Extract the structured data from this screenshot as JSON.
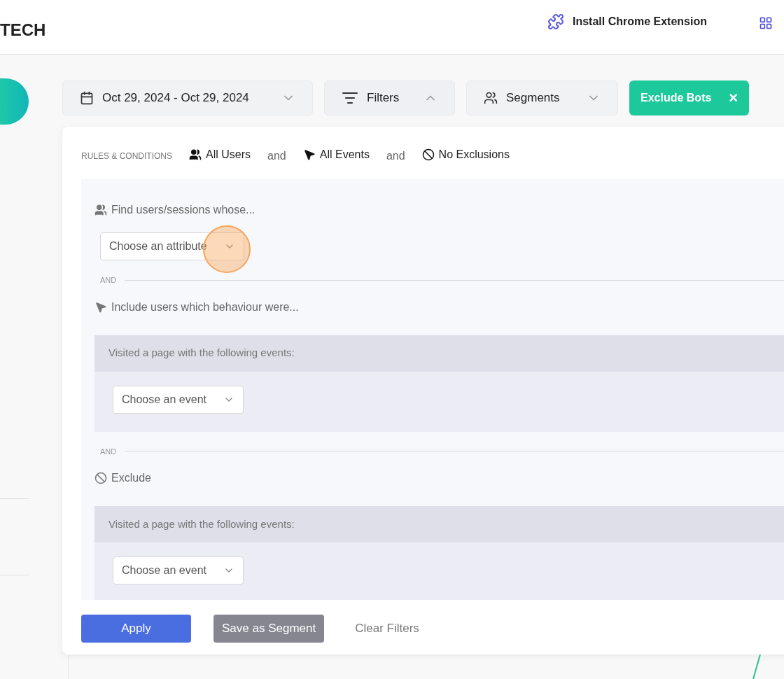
{
  "header": {
    "brand": "TECH",
    "extension_link": "Install Chrome Extension"
  },
  "toolbar": [
    {
      "kind": "date",
      "label": "Oct 29, 2024 - Oct 29, 2024",
      "expanded": false
    },
    {
      "kind": "filters",
      "label": "Filters",
      "expanded": true
    },
    {
      "kind": "segments",
      "label": "Segments",
      "expanded": false
    }
  ],
  "exclude_bots": {
    "label": "Exclude Bots",
    "close": "×"
  },
  "rules": {
    "label": "RULES & CONDITIONS",
    "summary": [
      {
        "kind": "users",
        "label": "All Users"
      },
      {
        "kind": "joiner",
        "label": "and"
      },
      {
        "kind": "events",
        "label": "All Events"
      },
      {
        "kind": "joiner",
        "label": "and"
      },
      {
        "kind": "exclusions",
        "label": "No Exclusions"
      }
    ]
  },
  "sections": [
    {
      "kind": "users",
      "heading": "Find users/sessions whose...",
      "select": {
        "placeholder": "Choose an attribute"
      },
      "separator": "AND"
    },
    {
      "kind": "events",
      "heading": "Include users which behaviour were...",
      "group_title": "Visited a page with the following events:",
      "select": {
        "placeholder": "Choose an event"
      },
      "separator": "AND"
    },
    {
      "kind": "exclusions",
      "heading": "Exclude",
      "group_title": "Visited a page with the following events:",
      "select": {
        "placeholder": "Choose an event"
      }
    }
  ],
  "actions": [
    {
      "kind": "primary",
      "label": "Apply"
    },
    {
      "kind": "secondary",
      "label": "Save as Segment"
    },
    {
      "kind": "link",
      "label": "Clear Filters"
    }
  ]
}
